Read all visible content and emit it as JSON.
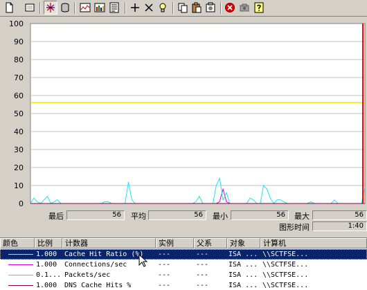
{
  "toolbar": {
    "buttons": [
      {
        "name": "new-counter-set-icon"
      },
      {
        "name": "clear-display-icon"
      },
      {
        "name": "view-current-activity-icon"
      },
      {
        "name": "view-log-data-icon"
      },
      {
        "name": "view-graph-icon"
      },
      {
        "name": "view-histogram-icon"
      },
      {
        "name": "view-report-icon"
      },
      {
        "name": "add-counter-icon"
      },
      {
        "name": "delete-counter-icon"
      },
      {
        "name": "highlight-icon"
      },
      {
        "name": "copy-properties-icon"
      },
      {
        "name": "paste-counter-list-icon"
      },
      {
        "name": "properties-icon"
      },
      {
        "name": "freeze-display-icon"
      },
      {
        "name": "update-data-icon"
      },
      {
        "name": "help-icon"
      }
    ]
  },
  "colors": {
    "background": "#d4d0c8",
    "selection": "#0a246a",
    "series_yellow": "#e8e020",
    "series_magenta": "#e000e0",
    "series_cyan": "#20e0f0",
    "series_maroon": "#800040",
    "current_time_bar": "#ff0000"
  },
  "chart_data": {
    "type": "line",
    "ylim": [
      0,
      100
    ],
    "y_ticks": [
      "100",
      "90",
      "80",
      "70",
      "60",
      "50",
      "40",
      "30",
      "20",
      "10",
      "0"
    ],
    "grid": true,
    "n_samples": 100,
    "current_index": 99,
    "series": [
      {
        "color": "#e8e020",
        "values": [
          56,
          56,
          56,
          56,
          56,
          56,
          56,
          56,
          56,
          56,
          56,
          56,
          56,
          56,
          56,
          56,
          56,
          56,
          56,
          56,
          56,
          56,
          56,
          56,
          56,
          56,
          56,
          56,
          56,
          56,
          56,
          56,
          56,
          56,
          56,
          56,
          56,
          56,
          56,
          56,
          56,
          56,
          56,
          56,
          56,
          56,
          56,
          56,
          56,
          56,
          56,
          56,
          56,
          56,
          56,
          56,
          56,
          56,
          56,
          56,
          56,
          56,
          56,
          56,
          56,
          56,
          56,
          56,
          56,
          56,
          56,
          56,
          56,
          56,
          56,
          56,
          56,
          56,
          56,
          56,
          56,
          56,
          56,
          56,
          56,
          56,
          56,
          56,
          56,
          56,
          56,
          56,
          56,
          56,
          56,
          56,
          56,
          56,
          56,
          56
        ]
      },
      {
        "color": "#e000e0",
        "values": [
          0,
          0,
          0,
          0,
          0,
          0,
          0,
          0,
          0,
          0,
          0,
          0,
          0,
          0,
          0,
          0,
          0,
          0,
          0,
          0,
          0,
          0,
          0,
          0,
          0,
          0,
          0,
          0,
          0,
          0,
          0,
          0,
          0,
          0,
          0,
          0,
          0,
          0,
          0,
          0,
          0,
          0,
          0,
          0,
          0,
          0,
          0,
          0,
          0,
          0,
          0,
          0,
          0,
          0,
          0,
          0,
          1,
          8,
          1,
          0,
          0,
          0,
          0,
          0,
          0,
          0,
          0,
          0,
          0,
          0,
          0,
          0,
          0,
          0,
          0,
          0,
          0,
          0,
          0,
          0,
          0,
          0,
          0,
          0,
          0,
          0,
          0,
          0,
          0,
          0,
          0,
          0,
          0,
          0,
          0,
          0,
          0,
          0,
          0,
          0
        ]
      },
      {
        "color": "#20e0f0",
        "values": [
          0,
          3,
          1,
          0,
          2,
          4,
          0,
          1,
          2,
          0,
          0,
          0,
          0,
          0,
          0,
          0,
          0,
          0,
          0,
          0,
          0,
          0,
          1,
          1,
          0,
          0,
          0,
          0,
          0,
          12,
          2,
          0,
          0,
          0,
          0,
          0,
          0,
          0,
          0,
          0,
          0,
          0,
          0,
          0,
          0,
          0,
          0,
          0,
          0,
          1,
          4,
          0,
          0,
          0,
          0,
          10,
          14,
          2,
          6,
          0,
          0,
          0,
          0,
          0,
          0,
          3,
          2,
          0,
          0,
          10,
          8,
          3,
          0,
          2,
          2,
          1,
          0,
          0,
          0,
          0,
          0,
          0,
          0,
          1,
          0,
          0,
          0,
          0,
          0,
          0,
          2,
          0,
          0,
          0,
          0,
          0,
          0,
          0,
          0,
          9
        ]
      },
      {
        "color": "#800040",
        "values": [
          0,
          0,
          0,
          0,
          0,
          0,
          0,
          0,
          0,
          0,
          0,
          0,
          0,
          0,
          0,
          0,
          0,
          0,
          0,
          0,
          0,
          0,
          0,
          0,
          0,
          0,
          0,
          0,
          0,
          0,
          0,
          0,
          0,
          0,
          0,
          0,
          0,
          0,
          0,
          0,
          0,
          0,
          0,
          0,
          0,
          0,
          0,
          0,
          0,
          0,
          0,
          0,
          0,
          0,
          0,
          0,
          0,
          0,
          0,
          0,
          0,
          0,
          0,
          0,
          0,
          0,
          0,
          0,
          0,
          0,
          0,
          0,
          0,
          0,
          0,
          0,
          0,
          0,
          0,
          0,
          0,
          0,
          0,
          0,
          0,
          0,
          0,
          0,
          0,
          0,
          0,
          0,
          0,
          0,
          0,
          0,
          0,
          0,
          0,
          0
        ]
      }
    ]
  },
  "stats": {
    "last_label": "最后",
    "last_value": "56",
    "average_label": "平均",
    "average_value": "56",
    "minimum_label": "最小",
    "minimum_value": "56",
    "maximum_label": "最大",
    "maximum_value": "56",
    "duration_label": "图形时间",
    "duration_value": "1:40"
  },
  "table": {
    "headers": [
      "颜色",
      "比例",
      "计数器",
      "实例",
      "父系",
      "对象",
      "计算机"
    ],
    "rows": [
      {
        "color": "#e8e020",
        "scale": "1.000",
        "counter": "Cache Hit Ratio (%)",
        "instance": "---",
        "parent": "---",
        "object": "ISA ...",
        "computer": "\\\\SCTFSE...",
        "selected": true
      },
      {
        "color": "#e000e0",
        "scale": "1.000",
        "counter": "Connections/sec",
        "instance": "---",
        "parent": "---",
        "object": "ISA ...",
        "computer": "\\\\SCTFSE...",
        "selected": false
      },
      {
        "color": "#20e0f0",
        "scale": "0.1...",
        "counter": "Packets/sec",
        "instance": "---",
        "parent": "---",
        "object": "ISA ...",
        "computer": "\\\\SCTFSE...",
        "selected": false
      },
      {
        "color": "#800040",
        "scale": "1.000",
        "counter": "DNS Cache Hits %",
        "instance": "---",
        "parent": "---",
        "object": "ISA ...",
        "computer": "\\\\SCTFSE...",
        "selected": false
      }
    ]
  }
}
